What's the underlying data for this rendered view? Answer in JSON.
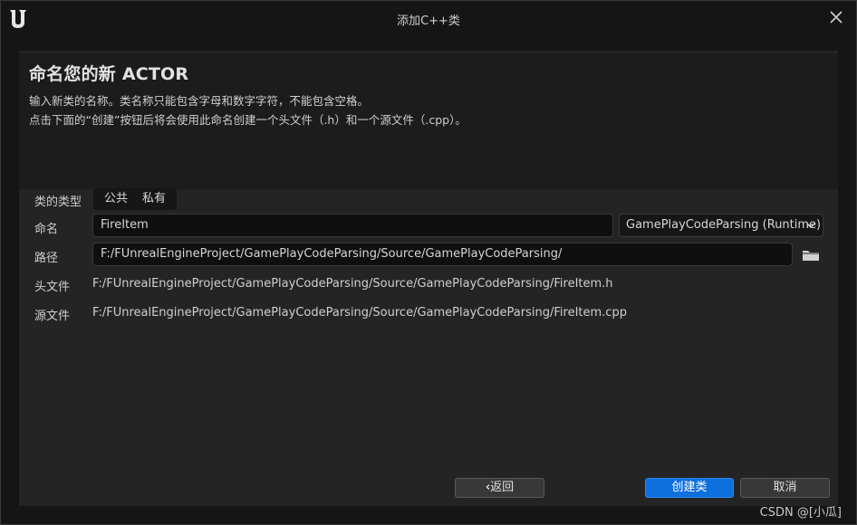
{
  "window": {
    "title": "添加C++类",
    "close_icon": "close-icon",
    "logo_icon": "unreal-logo"
  },
  "header": {
    "title": "命名您的新 ACTOR",
    "description_line1": "输入新类的名称。类名称只能包含字母和数字字符，不能包含空格。",
    "description_line2": "点击下面的“创建”按钮后将会使用此命名创建一个头文件（.h）和一个源文件（.cpp）。"
  },
  "form": {
    "class_type": {
      "label": "类的类型",
      "options": [
        "公共",
        "私有"
      ]
    },
    "name": {
      "label": "命名",
      "value": "FireItem",
      "module_dropdown": "GamePlayCodeParsing (Runtime)"
    },
    "path": {
      "label": "路径",
      "value": "F:/FUnrealEngineProject/GamePlayCodeParsing/Source/GamePlayCodeParsing/",
      "browse_icon": "folder-icon"
    },
    "header_file": {
      "label": "头文件",
      "value": "F:/FUnrealEngineProject/GamePlayCodeParsing/Source/GamePlayCodeParsing/FireItem.h"
    },
    "source_file": {
      "label": "源文件",
      "value": "F:/FUnrealEngineProject/GamePlayCodeParsing/Source/GamePlayCodeParsing/FireItem.cpp"
    }
  },
  "buttons": {
    "back": "返回",
    "create": "创建类",
    "cancel": "取消"
  },
  "watermark": "CSDN @[小瓜]",
  "colors": {
    "accent": "#0e6fde",
    "background": "#151515",
    "panel": "#242424"
  }
}
